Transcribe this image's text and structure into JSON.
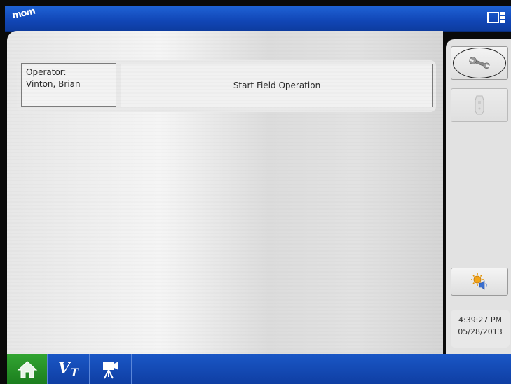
{
  "header": {
    "logo_text": "mom",
    "display_icon": "display-layout-icon"
  },
  "operator": {
    "label": "Operator:",
    "name": "Vinton, Brian"
  },
  "start_field_operation": {
    "label": "Start Field Operation"
  },
  "side_buttons": {
    "tools_icon": "wrench-icon",
    "device_icon": "handheld-device-icon",
    "setup_icon": "sun-speaker-icon"
  },
  "clock": {
    "time": "4:39:27 PM",
    "date": "05/28/2013"
  },
  "bottom_tabs": [
    {
      "name": "home",
      "icon": "home-icon"
    },
    {
      "name": "virtual-terminal",
      "icon": "vt-icon",
      "label": "V",
      "sub": "T"
    },
    {
      "name": "camera",
      "icon": "camera-icon"
    }
  ],
  "colors": {
    "top_bar": "#1a57c6",
    "home_tab": "#2a9a2b",
    "panel": "#e5e5e5"
  }
}
